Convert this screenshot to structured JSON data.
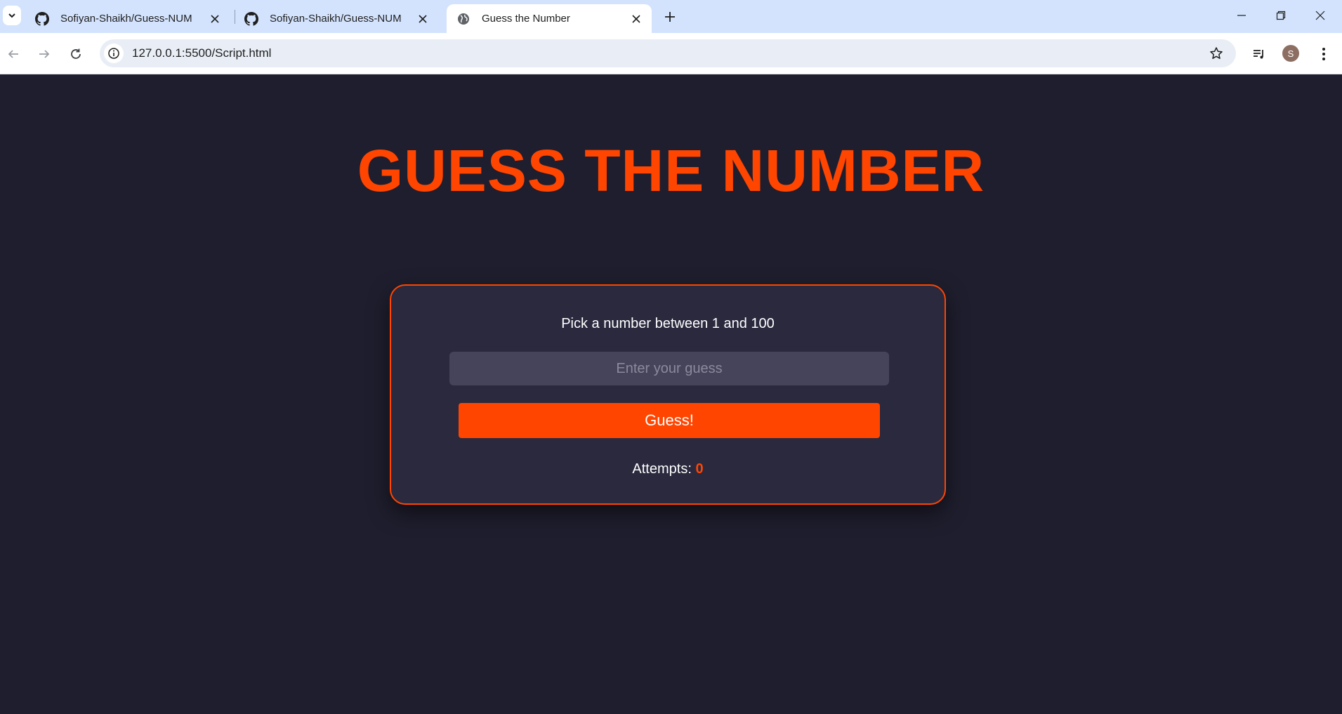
{
  "browser": {
    "tabs": [
      {
        "title": "Sofiyan-Shaikh/Guess-NUM",
        "icon": "github-icon",
        "active": false
      },
      {
        "title": "Sofiyan-Shaikh/Guess-NUM",
        "icon": "github-icon",
        "active": false
      },
      {
        "title": "Guess the Number",
        "icon": "globe-icon",
        "active": true
      }
    ],
    "url": "127.0.0.1:5500/Script.html",
    "profile_initial": "S"
  },
  "page": {
    "headline": "GUESS THE NUMBER",
    "prompt": "Pick a number between 1 and 100",
    "input_placeholder": "Enter your guess",
    "input_value": "",
    "button_label": "Guess!",
    "attempts_label": "Attempts:",
    "attempts_count": "0"
  },
  "colors": {
    "accent": "#ff4500",
    "background": "#1f1e2e",
    "card": "#2a293e",
    "input": "#45445a"
  }
}
